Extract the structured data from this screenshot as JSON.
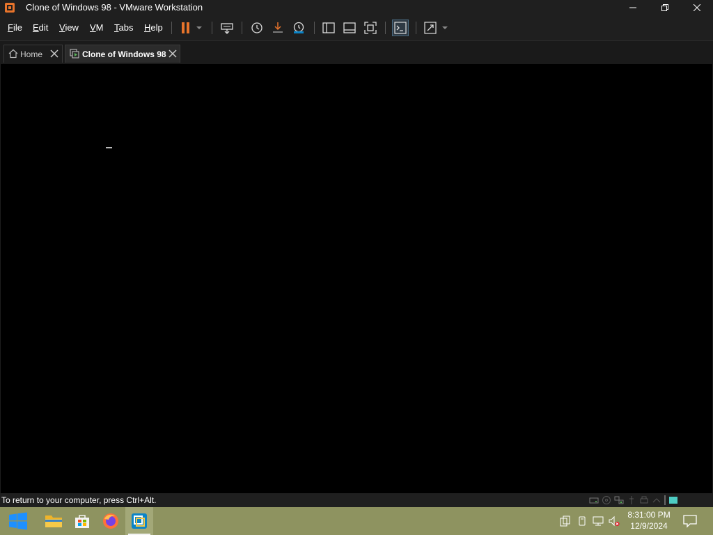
{
  "window": {
    "title": "Clone of Windows 98 - VMware Workstation",
    "icon": "vmware-icon",
    "controls": [
      "minimize-icon",
      "restore-icon",
      "close-icon"
    ]
  },
  "menu": {
    "items": [
      "File",
      "Edit",
      "View",
      "VM",
      "Tabs",
      "Help"
    ]
  },
  "toolbar": {
    "buttons": [
      "pause-icon",
      "dropdown-arrow-icon",
      "send-ctrl-alt-del-icon",
      "snapshot-icon",
      "revert-snapshot-icon",
      "snapshot-manager-icon",
      "library-icon",
      "thumbnail-bar-icon",
      "full-screen-icon",
      "console-view-icon",
      "stretch-icon",
      "dropdown-arrow-icon"
    ]
  },
  "tabs": [
    {
      "label": "Home",
      "icon": "home-icon",
      "active": false
    },
    {
      "label": "Clone of Windows 98",
      "icon": "vm-icon",
      "active": true
    }
  ],
  "status": {
    "message": "To return to your computer, press Ctrl+Alt."
  },
  "taskbar": {
    "apps": [
      "windows-start-icon",
      "file-explorer-icon",
      "store-icon",
      "firefox-icon",
      "vmware-icon"
    ],
    "time": "8:31:00 PM",
    "date": "12/9/2024"
  },
  "colors": {
    "window_bg": "#1f1f1f",
    "vm_screen": "#000000",
    "taskbar": "#8e9360",
    "pause_orange": "#e8742b",
    "accent_blue": "#0a84c7"
  }
}
